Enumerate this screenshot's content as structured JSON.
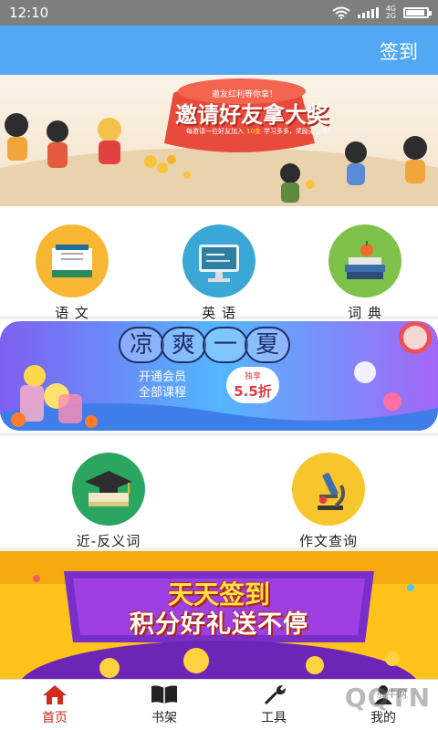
{
  "status_bar": {
    "time": "12:10",
    "network": [
      "4G",
      "2G"
    ],
    "battery_level": 0.92
  },
  "header": {
    "signin_label": "签到"
  },
  "banner_invite": {
    "title": "邀请好友拿大奖",
    "caption": "邀友红利等你拿！",
    "subtitle": "每邀请一位好友加入",
    "bonus": "10金",
    "bonus_tail": "学习多多，奖励无上限！"
  },
  "categories_top": [
    {
      "label": "语 文",
      "icon": "book-icon",
      "color": "#f7b733"
    },
    {
      "label": "英 语",
      "icon": "monitor-icon",
      "color": "#3aa7d6"
    },
    {
      "label": "词 典",
      "icon": "books-stack-icon",
      "color": "#7ec24b"
    }
  ],
  "banner_summer": {
    "title_chars": [
      "凉",
      "爽",
      "一",
      "夏"
    ],
    "line1": "开通会员",
    "line2": "全部课程",
    "tag": "独享",
    "discount": "5.5折"
  },
  "categories_bottom": [
    {
      "label": "近-反义词",
      "icon": "graduation-cap-icon",
      "color": "#2aa661"
    },
    {
      "label": "作文查询",
      "icon": "microscope-icon",
      "color": "#f7c52c"
    }
  ],
  "banner_checkin": {
    "line1": "天天签到",
    "line2": "积分好礼送不停"
  },
  "tabs": [
    {
      "label": "首页",
      "icon": "home-icon",
      "active": true
    },
    {
      "label": "书架",
      "icon": "open-book-icon",
      "active": false
    },
    {
      "label": "工具",
      "icon": "tools-icon",
      "active": false
    },
    {
      "label": "我的",
      "icon": "user-icon",
      "active": false
    }
  ],
  "watermark": {
    "main": "QQTN",
    "sub": "腾牛网"
  }
}
